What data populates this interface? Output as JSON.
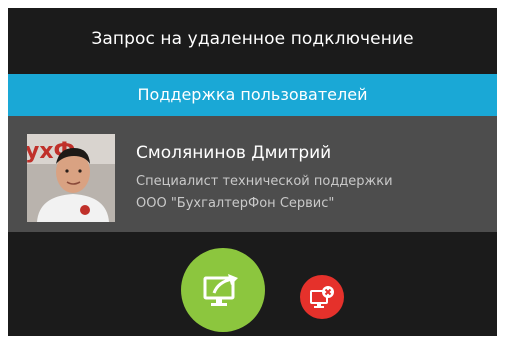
{
  "dialog": {
    "title": "Запрос на удаленное подключение"
  },
  "section": {
    "label": "Поддержка пользователей"
  },
  "agent": {
    "name": "Смолянинов Дмитрий",
    "role": "Специалист технической поддержки",
    "company": "ООО \"БухгалтерФон Сервис\"",
    "avatar_icon": "person-photo"
  },
  "actions": {
    "accept_icon": "monitor-connect-icon",
    "decline_icon": "monitor-disconnect-icon"
  },
  "colors": {
    "dialog_bg": "#1b1b1b",
    "accent": "#1aa8d6",
    "card_bg": "#4d4d4d",
    "accept": "#8cc63e",
    "decline": "#e5312b"
  }
}
